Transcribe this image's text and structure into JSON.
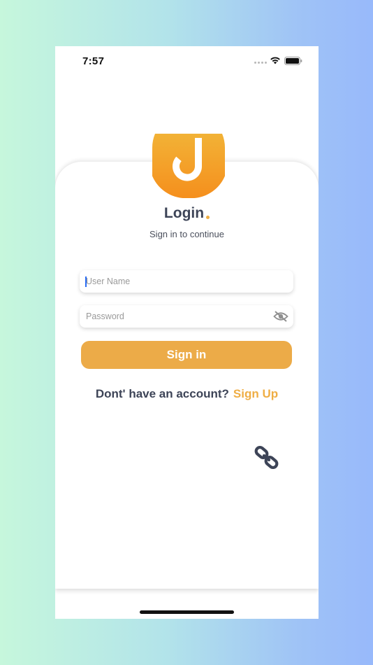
{
  "status_bar": {
    "time": "7:57",
    "icons": [
      "signal-dots-icon",
      "wifi-icon",
      "battery-icon"
    ]
  },
  "logo": {
    "icon": "d-logo-icon",
    "color": "#f39a1e"
  },
  "login": {
    "title": "Login",
    "subtitle": "Sign in to continue",
    "username_placeholder": "User Name",
    "username_value": "",
    "password_placeholder": "Password",
    "password_value": "",
    "password_toggle_icon": "eye-off-icon",
    "signin_label": "Sign in",
    "signup_prompt": "Dont' have an account?",
    "signup_link": "Sign Up"
  },
  "floating_icon": "link-icon",
  "colors": {
    "accent": "#ecab48",
    "text_dark": "#3d4457",
    "background_start": "#c6f7dc",
    "background_end": "#98b9fb"
  }
}
